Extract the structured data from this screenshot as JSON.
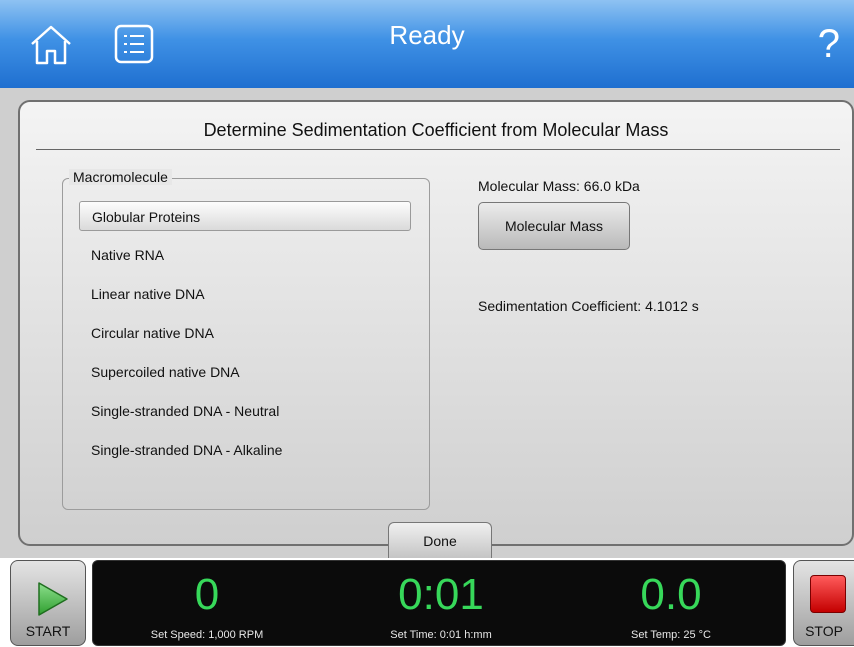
{
  "header": {
    "title": "Ready",
    "icons": {
      "home": "home-icon",
      "list": "list-icon",
      "help": "help-icon"
    },
    "help_glyph": "?"
  },
  "dialog": {
    "title": "Determine Sedimentation Coefficient from Molecular Mass",
    "group_label": "Macromolecule",
    "items": [
      {
        "label": "Globular Proteins",
        "selected": true
      },
      {
        "label": "Native RNA"
      },
      {
        "label": "Linear native DNA"
      },
      {
        "label": "Circular native DNA"
      },
      {
        "label": "Supercoiled native DNA"
      },
      {
        "label": "Single-stranded DNA - Neutral"
      },
      {
        "label": "Single-stranded DNA - Alkaline"
      }
    ],
    "molecular_mass_label": "Molecular Mass: 66.0 kDa",
    "molecular_mass_button": "Molecular Mass",
    "sedimentation_label": "Sedimentation Coefficient: 4.1012 s",
    "done_button": "Done"
  },
  "footer": {
    "start_label": "START",
    "stop_label": "STOP",
    "speed_value": "0",
    "speed_set": "Set Speed: 1,000 RPM",
    "time_value": "0:01",
    "time_set": "Set Time: 0:01 h:mm",
    "temp_value": "0.0",
    "temp_set": "Set Temp: 25 °C"
  },
  "colors": {
    "header_blue": "#3f91e5",
    "value_green": "#37d85a",
    "stop_red": "#e01010",
    "start_green": "#3bbf3b"
  }
}
